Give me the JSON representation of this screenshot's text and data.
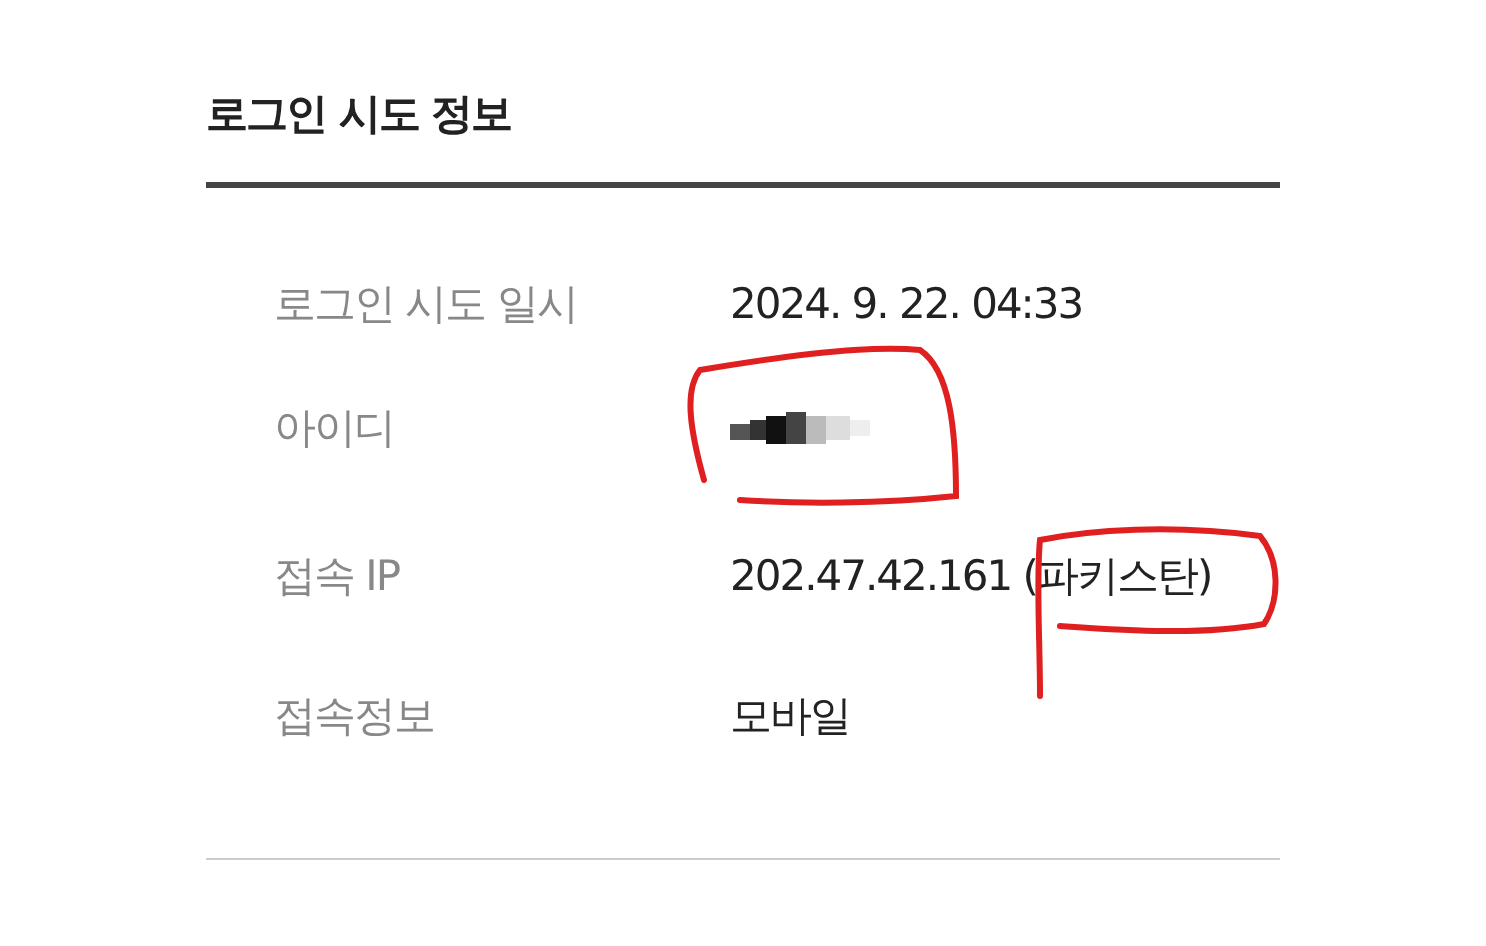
{
  "section": {
    "title": "로그인 시도 정보"
  },
  "rows": [
    {
      "label": "로그인 시도 일시",
      "kind": "text",
      "value": "2024. 9. 22. 04:33"
    },
    {
      "label": "아이디",
      "kind": "redacted"
    },
    {
      "label": "접속 IP",
      "kind": "text",
      "value": "202.47.42.161 (파키스탄)"
    },
    {
      "label": "접속정보",
      "kind": "text",
      "value": "모바일"
    }
  ]
}
